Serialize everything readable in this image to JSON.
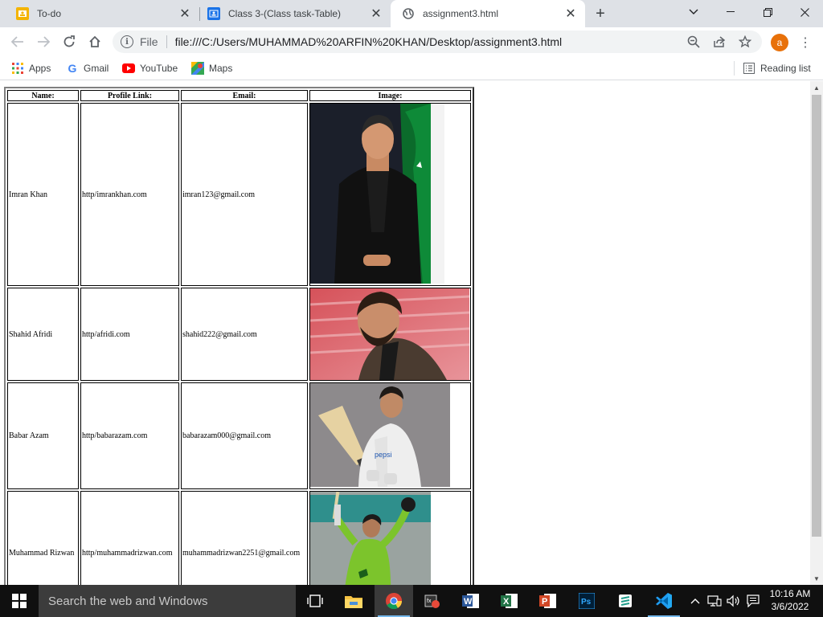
{
  "browser": {
    "tabs": [
      {
        "title": "To-do",
        "icon": "todo-icon",
        "active": false
      },
      {
        "title": "Class 3-(Class task-Table)",
        "icon": "classroom-icon",
        "active": false
      },
      {
        "title": "assignment3.html",
        "icon": "globe-icon",
        "active": true
      }
    ],
    "omnibox": {
      "scheme_label": "File",
      "url": "file:///C:/Users/MUHAMMAD%20ARFIN%20KHAN/Desktop/assignment3.html"
    },
    "profile_initial": "a",
    "bookmarks": [
      {
        "label": "Apps",
        "icon": "apps-grid-icon"
      },
      {
        "label": "Gmail",
        "icon": "google-icon"
      },
      {
        "label": "YouTube",
        "icon": "youtube-icon"
      },
      {
        "label": "Maps",
        "icon": "maps-icon"
      }
    ],
    "reading_list_label": "Reading list"
  },
  "table": {
    "headers": [
      "Name:",
      "Profile Link:",
      "Email:",
      "Image:"
    ],
    "rows": [
      {
        "name": "Imran Khan",
        "link": "http/imrankhan.com",
        "email": "imran123@gmail.com",
        "image": "photo-imran-khan"
      },
      {
        "name": "Shahid Afridi",
        "link": "http/afridi.com",
        "email": "shahid222@gmail.com",
        "image": "photo-shahid-afridi"
      },
      {
        "name": "Babar Azam",
        "link": "http/babarazam.com",
        "email": "babarazam000@gmail.com",
        "image": "photo-babar-azam"
      },
      {
        "name": "Muhammad Rizwan",
        "link": "http/muhammadrizwan.com",
        "email": "muhammadrizwan2251@gmail.com",
        "image": "photo-muhammad-rizwan"
      }
    ]
  },
  "taskbar": {
    "search_placeholder": "Search the web and Windows",
    "time": "10:16 AM",
    "date": "3/6/2022"
  }
}
